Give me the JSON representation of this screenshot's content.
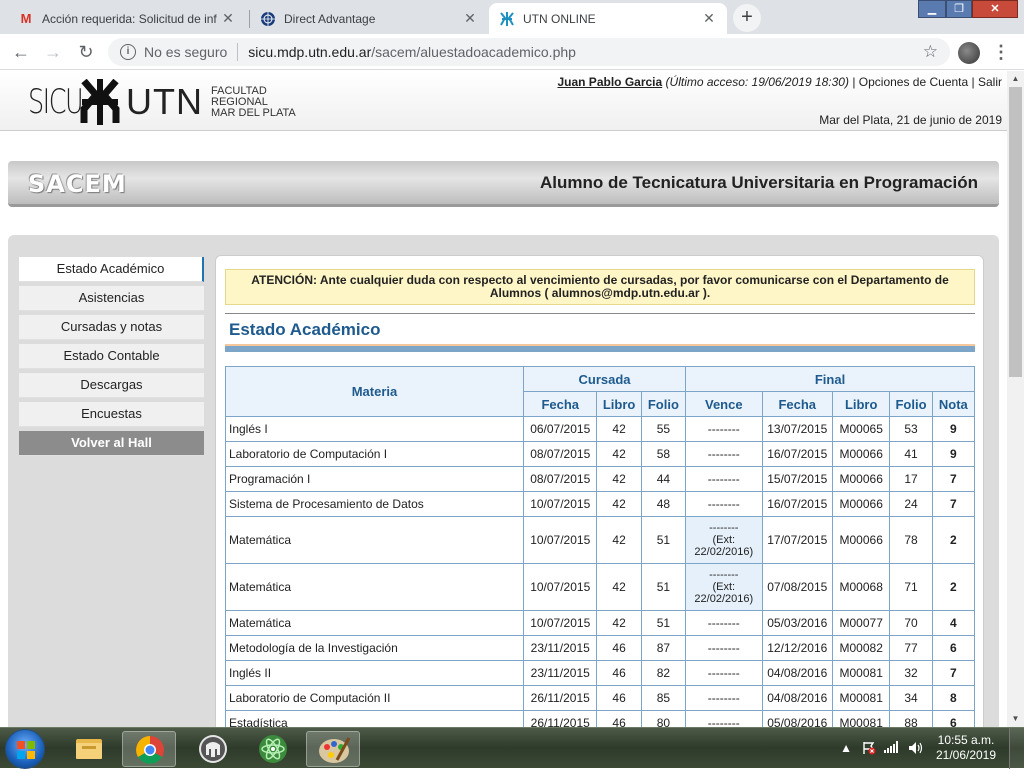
{
  "browser": {
    "tabs": [
      {
        "title": "Acción requerida: Solicitud de inf",
        "favicon": "gmail-icon"
      },
      {
        "title": "Direct Advantage",
        "favicon": "globe-icon"
      },
      {
        "title": "UTN ONLINE",
        "favicon": "utn-icon"
      }
    ],
    "new_tab": "+",
    "security_label": "No es seguro",
    "url_host": "sicu.mdp.utn.edu.ar",
    "url_path": "/sacem/aluestadoacademico.php"
  },
  "header": {
    "logo_sicu": "SICU",
    "logo_utn": "UTN",
    "logo_faculty": [
      "FACULTAD",
      "REGIONAL",
      "MAR DEL PLATA"
    ],
    "user_name": "Juan Pablo Garcia",
    "last_access": "(Último acceso: 19/06/2019 18:30)",
    "account_options": "Opciones de Cuenta",
    "logout": "Salir",
    "date": "Mar del Plata, 21 de junio de 2019"
  },
  "banner": {
    "brand": "SACEM",
    "role": "Alumno de Tecnicatura Universitaria en Programación"
  },
  "menu": [
    "Estado Académico",
    "Asistencias",
    "Cursadas y notas",
    "Estado Contable",
    "Descargas",
    "Encuestas",
    "Volver al Hall"
  ],
  "notice": "ATENCIÓN: Ante cualquier duda con respecto al vencimiento de cursadas, por favor comunicarse con el Departamento de Alumnos ( alumnos@mdp.utn.edu.ar ).",
  "section_title": "Estado Académico",
  "table": {
    "col_materia": "Materia",
    "group_cursada": "Cursada",
    "group_final": "Final",
    "cursada_cols": [
      "Fecha",
      "Libro",
      "Folio"
    ],
    "final_cols": [
      "Vence",
      "Fecha",
      "Libro",
      "Folio",
      "Nota"
    ],
    "rows": [
      {
        "materia": "Inglés I",
        "c_fecha": "06/07/2015",
        "c_libro": "42",
        "c_folio": "55",
        "vence": "--------",
        "f_fecha": "13/07/2015",
        "f_libro": "M00065",
        "f_folio": "53",
        "nota": "9"
      },
      {
        "materia": "Laboratorio de Computación I",
        "c_fecha": "08/07/2015",
        "c_libro": "42",
        "c_folio": "58",
        "vence": "--------",
        "f_fecha": "16/07/2015",
        "f_libro": "M00066",
        "f_folio": "41",
        "nota": "9"
      },
      {
        "materia": "Programación I",
        "c_fecha": "08/07/2015",
        "c_libro": "42",
        "c_folio": "44",
        "vence": "--------",
        "f_fecha": "15/07/2015",
        "f_libro": "M00066",
        "f_folio": "17",
        "nota": "7"
      },
      {
        "materia": "Sistema de Procesamiento de Datos",
        "c_fecha": "10/07/2015",
        "c_libro": "42",
        "c_folio": "48",
        "vence": "--------",
        "f_fecha": "16/07/2015",
        "f_libro": "M00066",
        "f_folio": "24",
        "nota": "7"
      },
      {
        "materia": "Matemática",
        "c_fecha": "10/07/2015",
        "c_libro": "42",
        "c_folio": "51",
        "vence": "--------",
        "vence_ext": "(Ext: 22/02/2016)",
        "f_fecha": "17/07/2015",
        "f_libro": "M00066",
        "f_folio": "78",
        "nota": "2"
      },
      {
        "materia": "Matemática",
        "c_fecha": "10/07/2015",
        "c_libro": "42",
        "c_folio": "51",
        "vence": "--------",
        "vence_ext": "(Ext: 22/02/2016)",
        "f_fecha": "07/08/2015",
        "f_libro": "M00068",
        "f_folio": "71",
        "nota": "2"
      },
      {
        "materia": "Matemática",
        "c_fecha": "10/07/2015",
        "c_libro": "42",
        "c_folio": "51",
        "vence": "--------",
        "f_fecha": "05/03/2016",
        "f_libro": "M00077",
        "f_folio": "70",
        "nota": "4"
      },
      {
        "materia": "Metodología de la Investigación",
        "c_fecha": "23/11/2015",
        "c_libro": "46",
        "c_folio": "87",
        "vence": "--------",
        "f_fecha": "12/12/2016",
        "f_libro": "M00082",
        "f_folio": "77",
        "nota": "6"
      },
      {
        "materia": "Inglés II",
        "c_fecha": "23/11/2015",
        "c_libro": "46",
        "c_folio": "82",
        "vence": "--------",
        "f_fecha": "04/08/2016",
        "f_libro": "M00081",
        "f_folio": "32",
        "nota": "7"
      },
      {
        "materia": "Laboratorio de Computación II",
        "c_fecha": "26/11/2015",
        "c_libro": "46",
        "c_folio": "85",
        "vence": "--------",
        "f_fecha": "04/08/2016",
        "f_libro": "M00081",
        "f_folio": "34",
        "nota": "8"
      },
      {
        "materia": "Estadística",
        "c_fecha": "26/11/2015",
        "c_libro": "46",
        "c_folio": "80",
        "vence": "--------",
        "f_fecha": "05/08/2016",
        "f_libro": "M00081",
        "f_folio": "88",
        "nota": "6"
      }
    ]
  },
  "taskbar": {
    "clock_time": "10:55 a.m.",
    "clock_date": "21/06/2019",
    "apps": [
      "file-explorer-icon",
      "chrome-icon",
      "elephant-app-icon",
      "atom-icon",
      "paint-icon"
    ]
  },
  "colors": {
    "accent_blue": "#1e5a8e",
    "table_border": "#7ca5c8",
    "notice_bg": "#fef6c7"
  }
}
